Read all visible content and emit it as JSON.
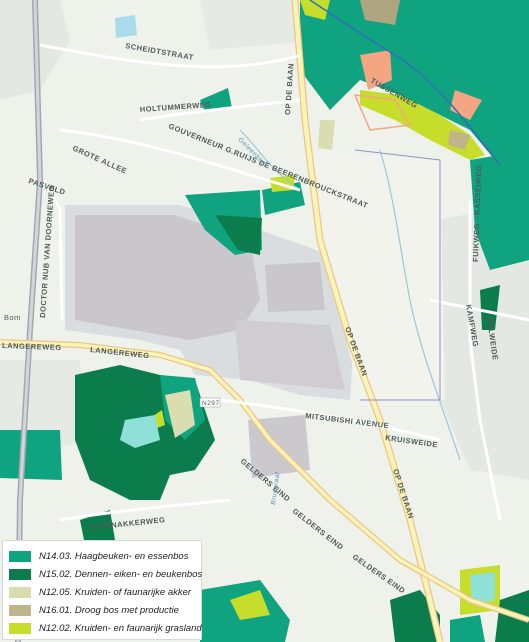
{
  "map": {
    "roads": {
      "scheidtstraat": "SCHEIDTSTRAAT",
      "holtummerweg": "HOLTUMMERWEG",
      "gouverneur": "GOUVERNEUR G.RUIJS DE BEERENBROUCKSTRAAT",
      "grote_allee": "GROTE ALLEE",
      "pasveld": "PASVELD",
      "doctor_nolensweg": "DOCTOR NUB VAN DOORNEWEG",
      "bom": "Bom",
      "langereweg_1": "LANGEREWEG",
      "langereweg_2": "LANGEREWEG",
      "op_de_baan_1": "OP DE BAAN",
      "op_de_baan_2": "OP DE BAAN",
      "op_de_baan_3": "OP DE BAAN",
      "mitsubishi": "MITSUBISHI AVENUE",
      "kruisweide": "KRUISWEIDE",
      "gelders_eind_1": "GELDERS EIND",
      "gelders_eind_2": "GELDERS EIND",
      "gelders_eind_3": "GELDERS EIND",
      "steenakkerweg": "STEENAKKERWEG",
      "kamfweg": "KAMFWEG",
      "delweide": "DELWEIDE",
      "fuikweg": "FUIKWEG - KASSEIWEG",
      "tussenweg": "TUSSENWEG",
      "n297": "N297",
      "geleenbeek": "Geleenbeek",
      "bruggraaf": "Bruggraaf"
    }
  },
  "legend": {
    "items": [
      {
        "label": "N14.03. Haagbeuken- en essenbos",
        "color": "#10a37f"
      },
      {
        "label": "N15.02. Dennen- eiken- en beukenbos",
        "color": "#0b7c4c"
      },
      {
        "label": "N12.05. Kruiden- of faunarijke akker",
        "color": "#d9ddb0"
      },
      {
        "label": "N16.01. Droog bos met productie",
        "color": "#bfb48a"
      },
      {
        "label": "N12.02. Kruiden- en faunarijk grasland",
        "color": "#c6dd2c"
      }
    ]
  }
}
